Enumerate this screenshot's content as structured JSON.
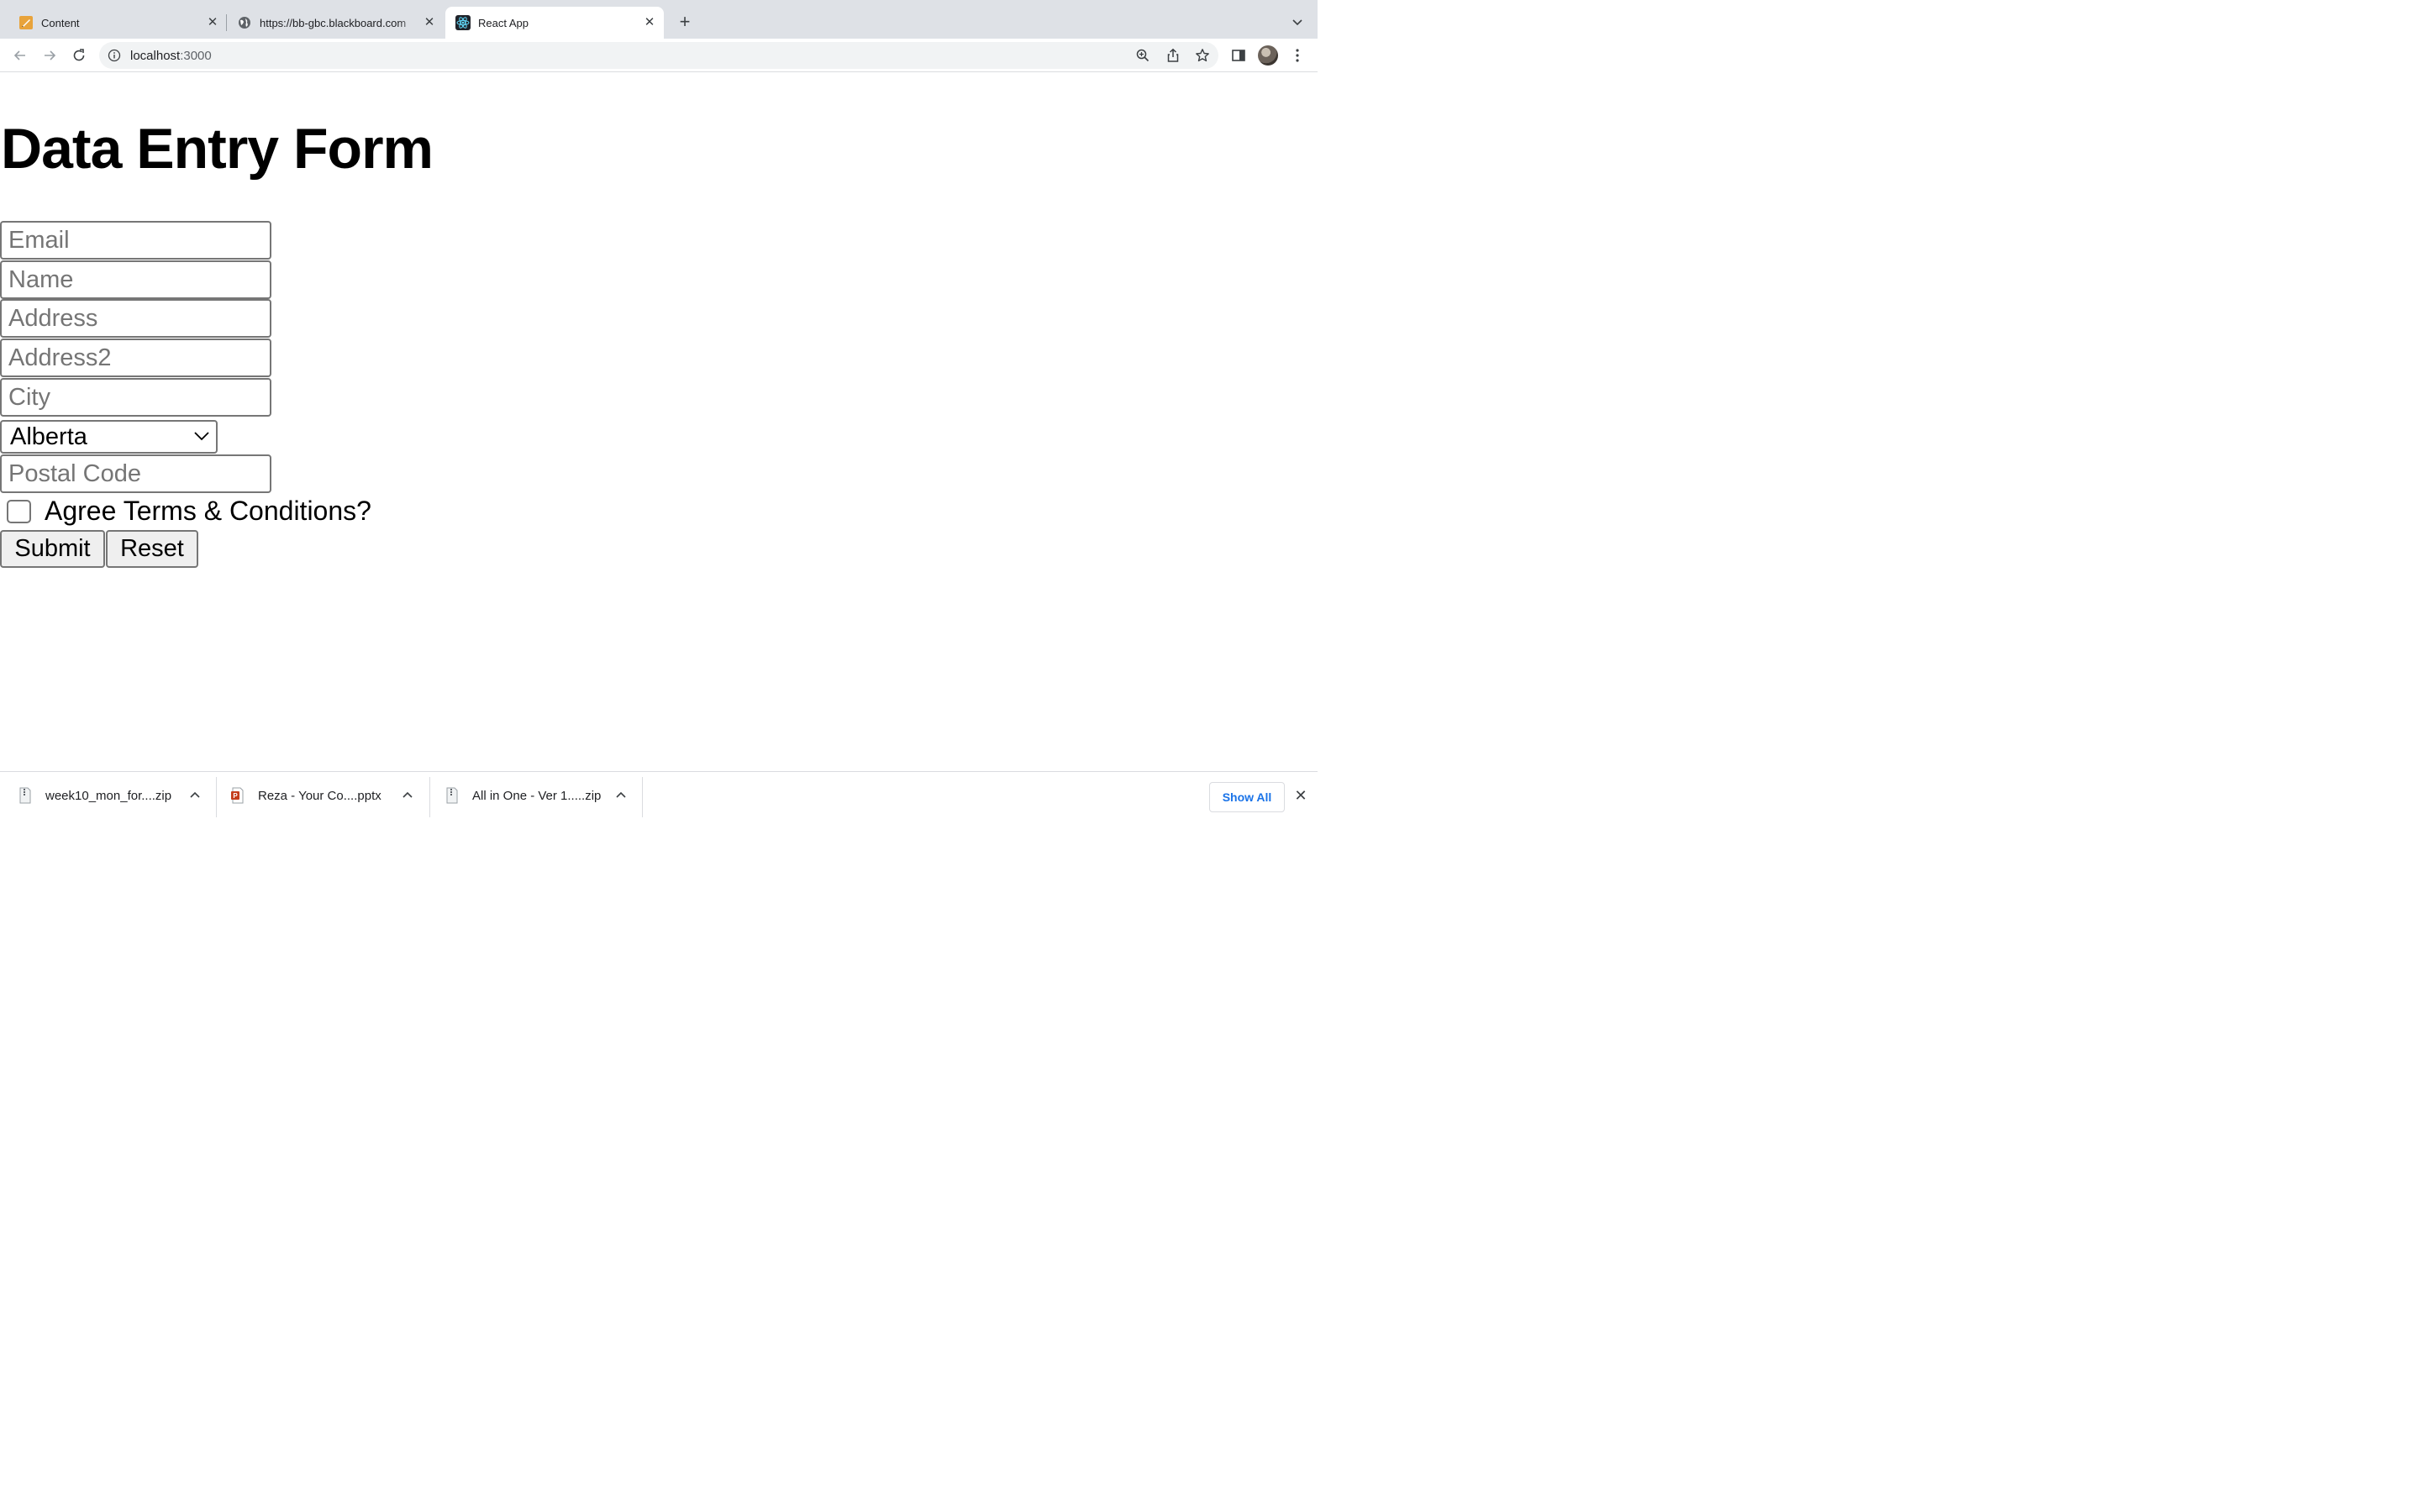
{
  "browser": {
    "tabs": [
      {
        "title": "Content",
        "icon": "pencil-note-icon"
      },
      {
        "title": "https://bb-gbc.blackboard.com",
        "icon": "globe-icon"
      },
      {
        "title": "React App",
        "icon": "react-icon"
      }
    ],
    "active_tab": 2,
    "new_tab_label": "+",
    "address": {
      "host": "localhost",
      "port": ":3000"
    }
  },
  "form": {
    "heading": "Data Entry Form",
    "fields": {
      "email": {
        "placeholder": "Email",
        "value": ""
      },
      "name": {
        "placeholder": "Name",
        "value": ""
      },
      "address": {
        "placeholder": "Address",
        "value": ""
      },
      "address2": {
        "placeholder": "Address2",
        "value": ""
      },
      "city": {
        "placeholder": "City",
        "value": ""
      },
      "province": {
        "selected": "Alberta"
      },
      "postal": {
        "placeholder": "Postal Code",
        "value": ""
      }
    },
    "agree_label": "Agree Terms & Conditions?",
    "agree_checked": false,
    "submit_label": "Submit",
    "reset_label": "Reset"
  },
  "downloads": {
    "items": [
      {
        "name": "week10_mon_for....zip",
        "type": "zip-file-icon"
      },
      {
        "name": "Reza - Your Co....pptx",
        "type": "powerpoint-file-icon"
      },
      {
        "name": "All in One - Ver 1.....zip",
        "type": "zip-file-icon"
      }
    ],
    "show_all_label": "Show All"
  },
  "colors": {
    "link_blue": "#1a73e8",
    "tab_bar": "#dee1e6",
    "pptx_red": "#c43e1c"
  }
}
